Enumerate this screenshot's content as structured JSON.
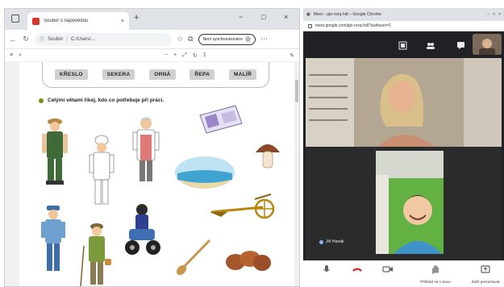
{
  "edge": {
    "tab_title": "Soubor s nápovědou",
    "tab_close": "×",
    "new_tab": "+",
    "window_controls": [
      "−",
      "□",
      "×"
    ],
    "address": {
      "label": "Soubor",
      "path": "C:/Users/...",
      "sync_label": "Není synchronizováno",
      "zoom": "100 %"
    },
    "pdf_toolbar": {
      "page": "1",
      "zoom_out": "−",
      "zoom_in": "+"
    },
    "icons": [
      "sidebar-icon",
      "back-icon",
      "refresh-icon",
      "favorites-icon",
      "collections-icon",
      "settings-icon"
    ]
  },
  "worksheet": {
    "words": [
      "KŘESLO",
      "SEKERA",
      "ORNÁ",
      "ŘEPA",
      "MALÍŘ"
    ],
    "instruction": "Celými větami říkej, kdo co potřebuje při práci."
  },
  "meet": {
    "window_title": "Meet – pjo-rvzq-hdt – Google Chrome",
    "url": "meet.google.com/pjo-rvzq-hdt?authuser=1",
    "participant_name": "Jiří Hanák",
    "controls": [
      {
        "name": "microphone-icon",
        "label": ""
      },
      {
        "name": "hangup-icon",
        "label": ""
      },
      {
        "name": "camera-icon",
        "label": ""
      },
      {
        "name": "raise-hand-icon",
        "label": "Přihlásit se o slovo"
      },
      {
        "name": "present-icon",
        "label": "Začít prezentovat"
      }
    ]
  },
  "colors": {
    "meet_background": "#202124",
    "edge_titlebar": "#dfe3e8",
    "instruction_bullet": "#7a8b1e",
    "hangup": "#d93025"
  }
}
